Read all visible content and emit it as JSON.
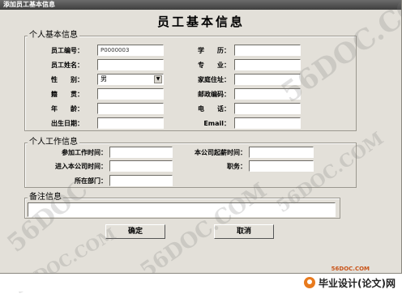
{
  "window": {
    "title": "添加员工基本信息"
  },
  "main_title": "员工基本信息",
  "personal": {
    "legend": "个人基本信息",
    "labels": {
      "emp_no": "员工编号：",
      "emp_name": "员工姓名：",
      "gender": "性　　别：",
      "native": "籍　　贯：",
      "age": "年　　龄：",
      "birthdate": "出生日期：",
      "education": "学　　历：",
      "major": "专　　业：",
      "address": "家庭住址：",
      "postcode": "邮政编码：",
      "phone": "电　　话：",
      "email": "Email："
    },
    "values": {
      "emp_no": "P0000003",
      "gender": "男"
    }
  },
  "work": {
    "legend": "个人工作信息",
    "labels": {
      "join_date": "参加工作时间：",
      "salary_start": "本公司起薪时间：",
      "company_join": "进入本公司时间：",
      "position": "职务：",
      "department": "所在部门："
    }
  },
  "notes": {
    "legend": "备注信息"
  },
  "buttons": {
    "ok": "确定",
    "cancel": "取消"
  },
  "watermarks": [
    "56DOC.COM",
    "56DOC",
    "56DOC.COM",
    "56DOC.COM",
    "56DOC.COM"
  ],
  "footer": {
    "url": "56DOC.COM",
    "brand": "毕业设计(论文)网"
  }
}
